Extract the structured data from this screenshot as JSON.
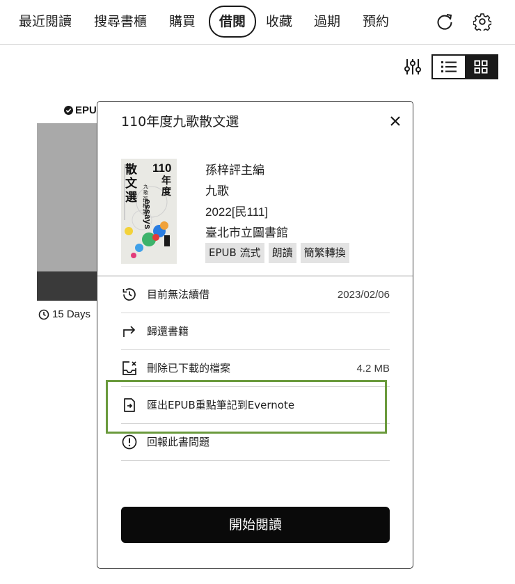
{
  "tabs": [
    {
      "label": "最近閱讀"
    },
    {
      "label": "搜尋書櫃"
    },
    {
      "label": "購買"
    },
    {
      "label": "借閱"
    },
    {
      "label": "收藏"
    },
    {
      "label": "過期"
    },
    {
      "label": "預約"
    }
  ],
  "active_tab": "借閱",
  "toolbar": {
    "refresh_icon": "refresh-icon",
    "settings_icon": "gear-icon"
  },
  "view": {
    "filter_icon": "sliders-icon",
    "list_icon": "list-icon",
    "grid_icon": "grid-icon",
    "selected": "grid"
  },
  "background_book": {
    "format_badge": "EPU",
    "days": "15 Days"
  },
  "modal": {
    "title": "110年度九歌散文選",
    "cover": {
      "title_vertical": "散文選",
      "year_line": "110",
      "year_line2": "年度",
      "english": "essays",
      "publisher": "九歌",
      "editor": "孫梓評"
    },
    "editor": "孫梓評主編",
    "publisher": "九歌",
    "year": "2022[民111]",
    "library": "臺北市立圖書館",
    "tags": [
      "EPUB 流式",
      "朗讀",
      "簡繁轉換"
    ],
    "rows": [
      {
        "label": "目前無法續借",
        "value": "2023/02/06",
        "icon": "history-icon"
      },
      {
        "label": "歸還書籍",
        "value": "",
        "icon": "return-icon"
      },
      {
        "label": "刪除已下載的檔案",
        "value": "4.2 MB",
        "icon": "delete-download-icon"
      },
      {
        "label": "匯出EPUB重點筆記到Evernote",
        "value": "",
        "icon": "export-icon"
      },
      {
        "label": "回報此書問題",
        "value": "",
        "icon": "alert-icon"
      }
    ],
    "start_button": "開始閱讀"
  },
  "colors": {
    "highlight": "#6a9a3c",
    "button": "#0a0a0a"
  }
}
